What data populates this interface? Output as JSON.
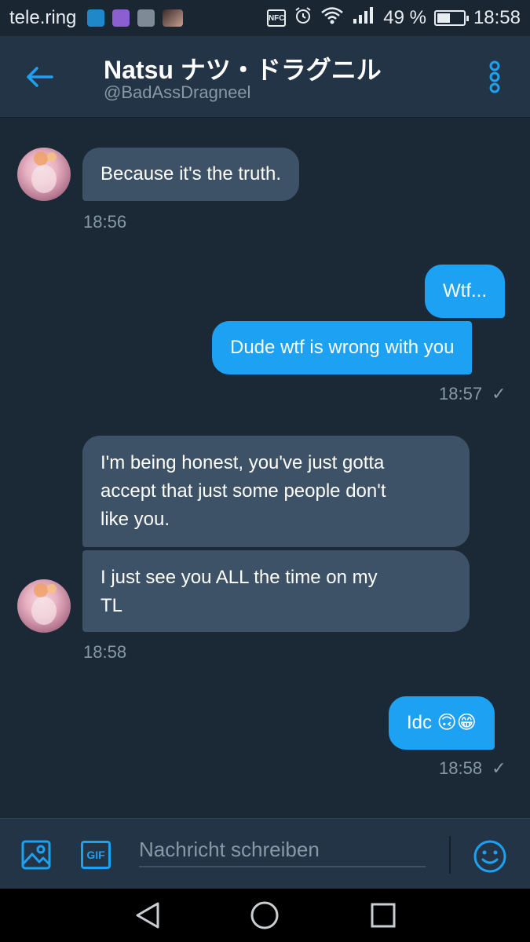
{
  "status_bar": {
    "carrier": "tele.ring",
    "notification_icons": [
      "app-icon",
      "keyboard-icon",
      "gallery-icon",
      "photo-thumbnail"
    ],
    "nfc_label": "NFC",
    "battery_percent": 49,
    "battery_text": "49 %",
    "time": "18:58"
  },
  "header": {
    "display_name": "Natsu ナツ・ドラグニル",
    "handle": "@BadAssDragneel"
  },
  "messages": [
    {
      "direction": "incoming",
      "text": "Because it's the truth.",
      "time": "18:56"
    },
    {
      "direction": "outgoing",
      "text": "Wtf..."
    },
    {
      "direction": "outgoing",
      "text": "Dude wtf is wrong with you",
      "time": "18:57",
      "read_check": "✓"
    },
    {
      "direction": "incoming",
      "text_lines": [
        "I'm being honest, you've just gotta",
        "accept that just some people don't",
        "like you."
      ]
    },
    {
      "direction": "incoming",
      "text_lines": [
        "I just see you ALL the time on my",
        "TL"
      ],
      "time": "18:58"
    },
    {
      "direction": "outgoing",
      "text": "Idc 🙃😁",
      "time": "18:58",
      "read_check": "✓"
    }
  ],
  "composer": {
    "placeholder": "Nachricht schreiben",
    "gif_label": "GIF"
  },
  "colors": {
    "background": "#1b2836",
    "header": "#243447",
    "incoming_bubble": "#3d5266",
    "outgoing_bubble": "#1da1f2",
    "accent": "#1da1f2",
    "muted_text": "#8899a6"
  }
}
